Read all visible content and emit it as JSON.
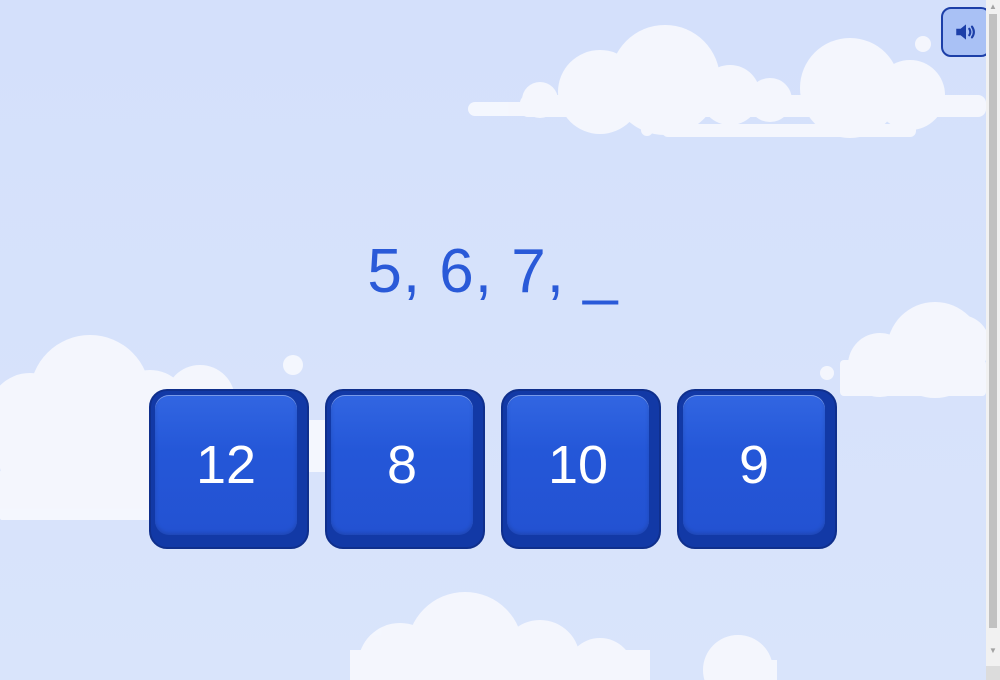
{
  "game": {
    "sequence_text": "5, 6, 7, _",
    "answers": [
      {
        "label": "12"
      },
      {
        "label": "8"
      },
      {
        "label": "10"
      },
      {
        "label": "9"
      }
    ]
  },
  "controls": {
    "sound_icon": "speaker-icon"
  },
  "scrollbar": {
    "up_arrow": "▲",
    "down_arrow": "▼"
  },
  "colors": {
    "background": "#d6e2fb",
    "accent": "#2a5ad8",
    "button": "#2457d8",
    "button_border": "#1239a6",
    "cloud": "#f4f7fe"
  }
}
